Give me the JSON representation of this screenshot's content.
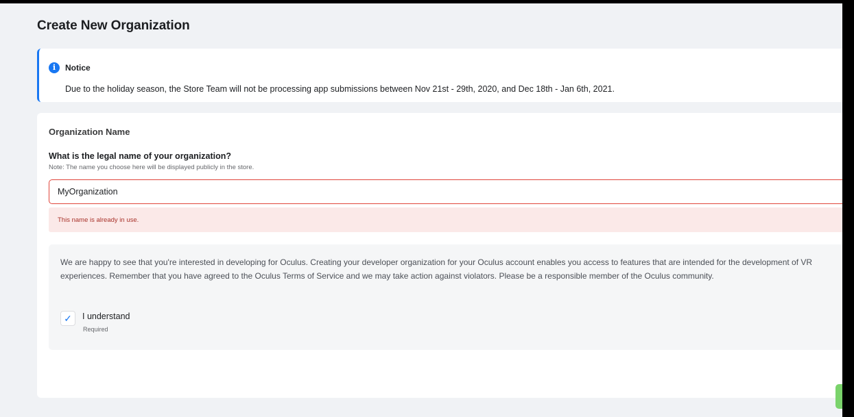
{
  "page": {
    "title": "Create New Organization"
  },
  "notice": {
    "icon": "info-icon",
    "icon_glyph": "i",
    "title": "Notice",
    "text": "Due to the holiday season, the Store Team will not be processing app submissions between Nov 21st - 29th, 2020, and Dec 18th - Jan 6th, 2021."
  },
  "form": {
    "section_title": "Organization Name",
    "question": "What is the legal name of your organization?",
    "note": "Note: The name you choose here will be displayed publicly in the store.",
    "name_value": "MyOrganization",
    "error": "This name is already in use."
  },
  "terms": {
    "text": "We are happy to see that you're interested in developing for Oculus. Creating your developer organization for your Oculus account enables you access to features that are intended for the development of VR experiences. Remember that you have agreed to the Oculus Terms of Service and we may take action against violators. Please be a responsible member of the Oculus community.",
    "checkbox_checked": true,
    "check_glyph": "✓",
    "checkbox_label": "I understand",
    "required_label": "Required"
  },
  "colors": {
    "accent": "#1877f2",
    "error_border": "#e0443a",
    "error_background": "#fbe9e8",
    "submit_button": "#7ad36b"
  }
}
